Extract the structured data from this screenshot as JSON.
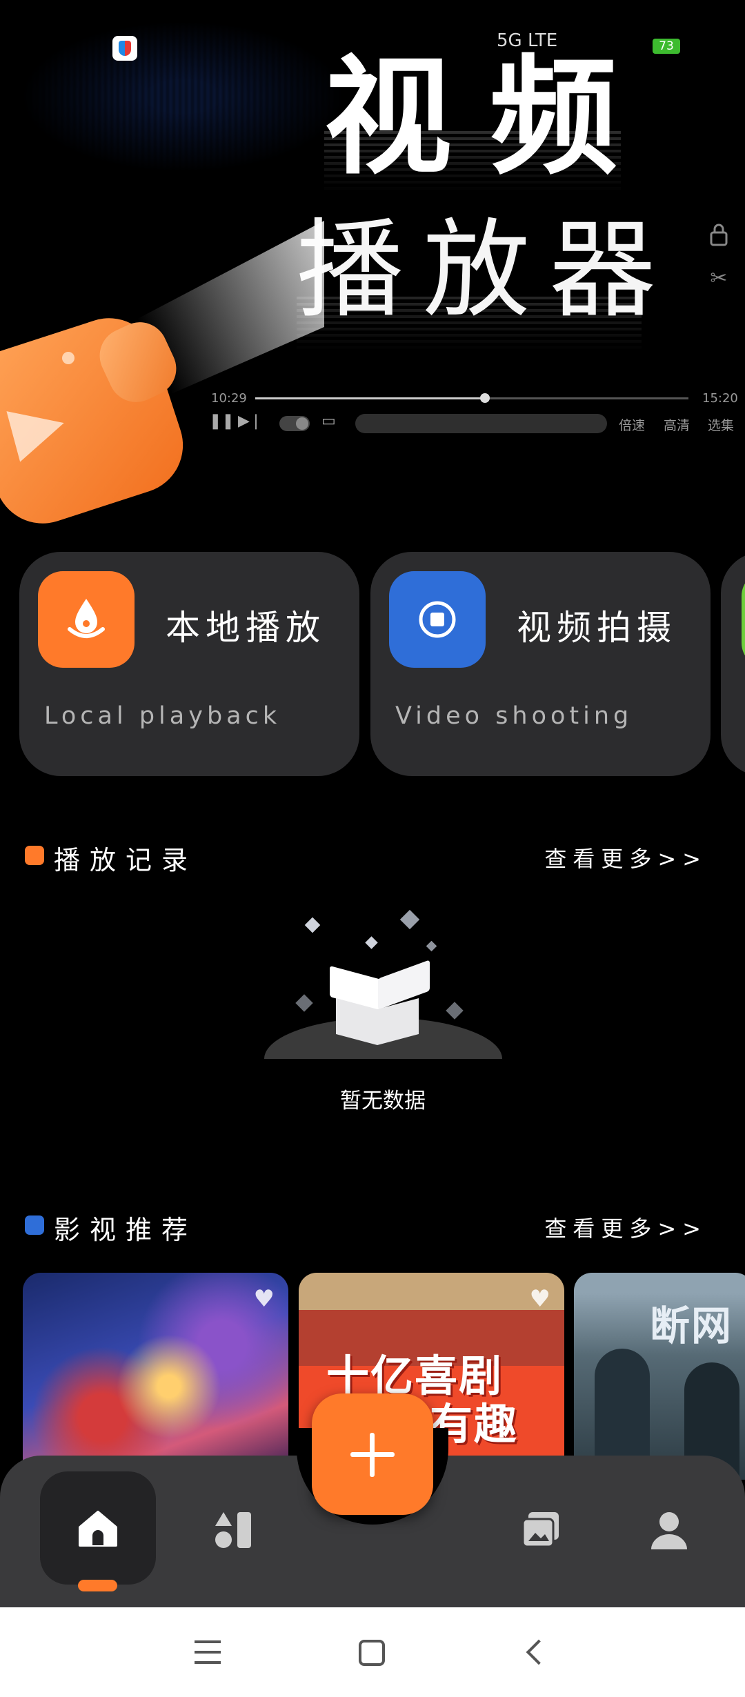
{
  "hero": {
    "title_line1": "视频",
    "title_line2": "播放器",
    "player": {
      "current_time": "10:29",
      "total_time": "15:20",
      "progress": 0.53,
      "speed_label": "倍速",
      "quality_label": "高清",
      "episodes_label": "选集"
    }
  },
  "status_bar": {
    "network": "5G  LTE",
    "battery": "73"
  },
  "actions": [
    {
      "title": "本地播放",
      "subtitle": "Local playback",
      "icon": "fire-drop-icon",
      "color": "#ff7a2a"
    },
    {
      "title": "视频拍摄",
      "subtitle": "Video shooting",
      "icon": "record-icon",
      "color": "#2f6ed8"
    }
  ],
  "history": {
    "title": "播放记录",
    "more": "查看更多>>",
    "accent": "#ff7a2a",
    "empty_text": "暂无数据"
  },
  "recommend": {
    "title": "影视推荐",
    "more": "查看更多>>",
    "accent": "#2f6ed8",
    "posters": [
      {
        "text": ""
      },
      {
        "text": "十亿喜剧\n有趣"
      },
      {
        "text": "断网"
      }
    ]
  },
  "nav": {
    "items": [
      "home-icon",
      "category-icon",
      "add-icon",
      "library-icon",
      "profile-icon"
    ],
    "accent": "#ff7a2a"
  }
}
